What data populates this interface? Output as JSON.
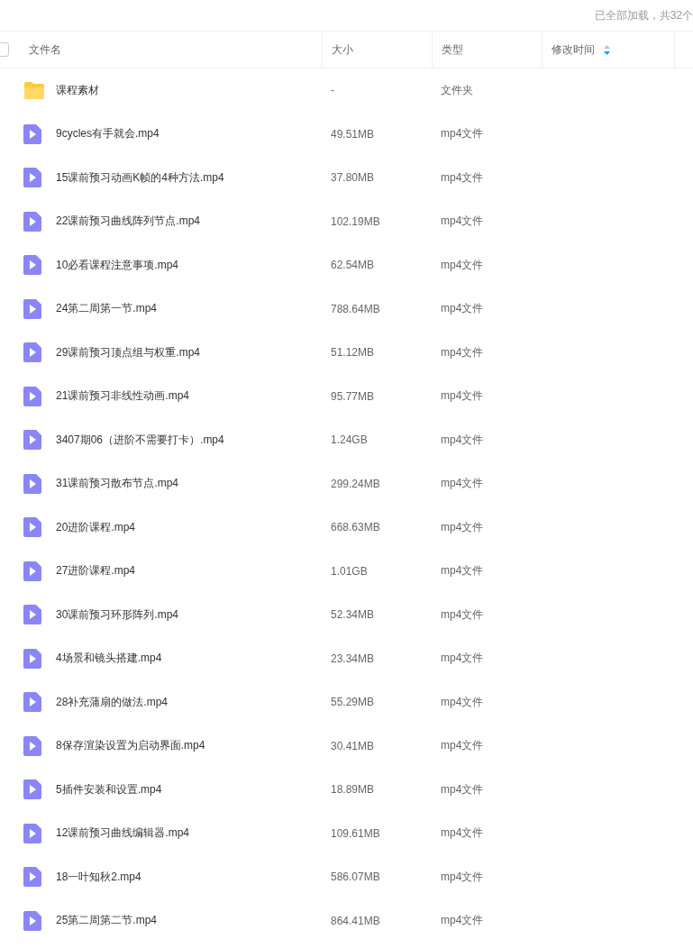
{
  "status": "已全部加载，共32个",
  "select_all": {
    "checked": false
  },
  "columns": [
    {
      "label": "文件名",
      "sorted": false
    },
    {
      "label": "大小",
      "sorted": false
    },
    {
      "label": "类型",
      "sorted": false
    },
    {
      "label": "修改时间",
      "sorted": true
    }
  ],
  "rows": [
    {
      "kind": "folder",
      "name": "课程素材",
      "size": "-",
      "type": "文件夹"
    },
    {
      "kind": "video",
      "name": "9cycles有手就会.mp4",
      "size": "49.51MB",
      "type": "mp4文件"
    },
    {
      "kind": "video",
      "name": "15课前预习动画K帧的4种方法.mp4",
      "size": "37.80MB",
      "type": "mp4文件"
    },
    {
      "kind": "video",
      "name": "22课前预习曲线阵列节点.mp4",
      "size": "102.19MB",
      "type": "mp4文件"
    },
    {
      "kind": "video",
      "name": "10必看课程注意事项.mp4",
      "size": "62.54MB",
      "type": "mp4文件"
    },
    {
      "kind": "video",
      "name": "24第二周第一节.mp4",
      "size": "788.64MB",
      "type": "mp4文件"
    },
    {
      "kind": "video",
      "name": "29课前预习顶点组与权重.mp4",
      "size": "51.12MB",
      "type": "mp4文件"
    },
    {
      "kind": "video",
      "name": "21课前预习非线性动画.mp4",
      "size": "95.77MB",
      "type": "mp4文件"
    },
    {
      "kind": "video",
      "name": "3407期06（进阶不需要打卡）.mp4",
      "size": "1.24GB",
      "type": "mp4文件"
    },
    {
      "kind": "video",
      "name": "31课前预习散布节点.mp4",
      "size": "299.24MB",
      "type": "mp4文件"
    },
    {
      "kind": "video",
      "name": "20进阶课程.mp4",
      "size": "668.63MB",
      "type": "mp4文件"
    },
    {
      "kind": "video",
      "name": "27进阶课程.mp4",
      "size": "1.01GB",
      "type": "mp4文件"
    },
    {
      "kind": "video",
      "name": "30课前预习环形阵列.mp4",
      "size": "52.34MB",
      "type": "mp4文件"
    },
    {
      "kind": "video",
      "name": "4场景和镜头搭建.mp4",
      "size": "23.34MB",
      "type": "mp4文件"
    },
    {
      "kind": "video",
      "name": "28补充蒲扇的做法.mp4",
      "size": "55.29MB",
      "type": "mp4文件"
    },
    {
      "kind": "video",
      "name": "8保存渲染设置为启动界面.mp4",
      "size": "30.41MB",
      "type": "mp4文件"
    },
    {
      "kind": "video",
      "name": "5插件安装和设置.mp4",
      "size": "18.89MB",
      "type": "mp4文件"
    },
    {
      "kind": "video",
      "name": "12课前预习曲线编辑器.mp4",
      "size": "109.61MB",
      "type": "mp4文件"
    },
    {
      "kind": "video",
      "name": "18一叶知秋2.mp4",
      "size": "586.07MB",
      "type": "mp4文件"
    },
    {
      "kind": "video",
      "name": "25第二周第二节.mp4",
      "size": "864.41MB",
      "type": "mp4文件"
    }
  ]
}
